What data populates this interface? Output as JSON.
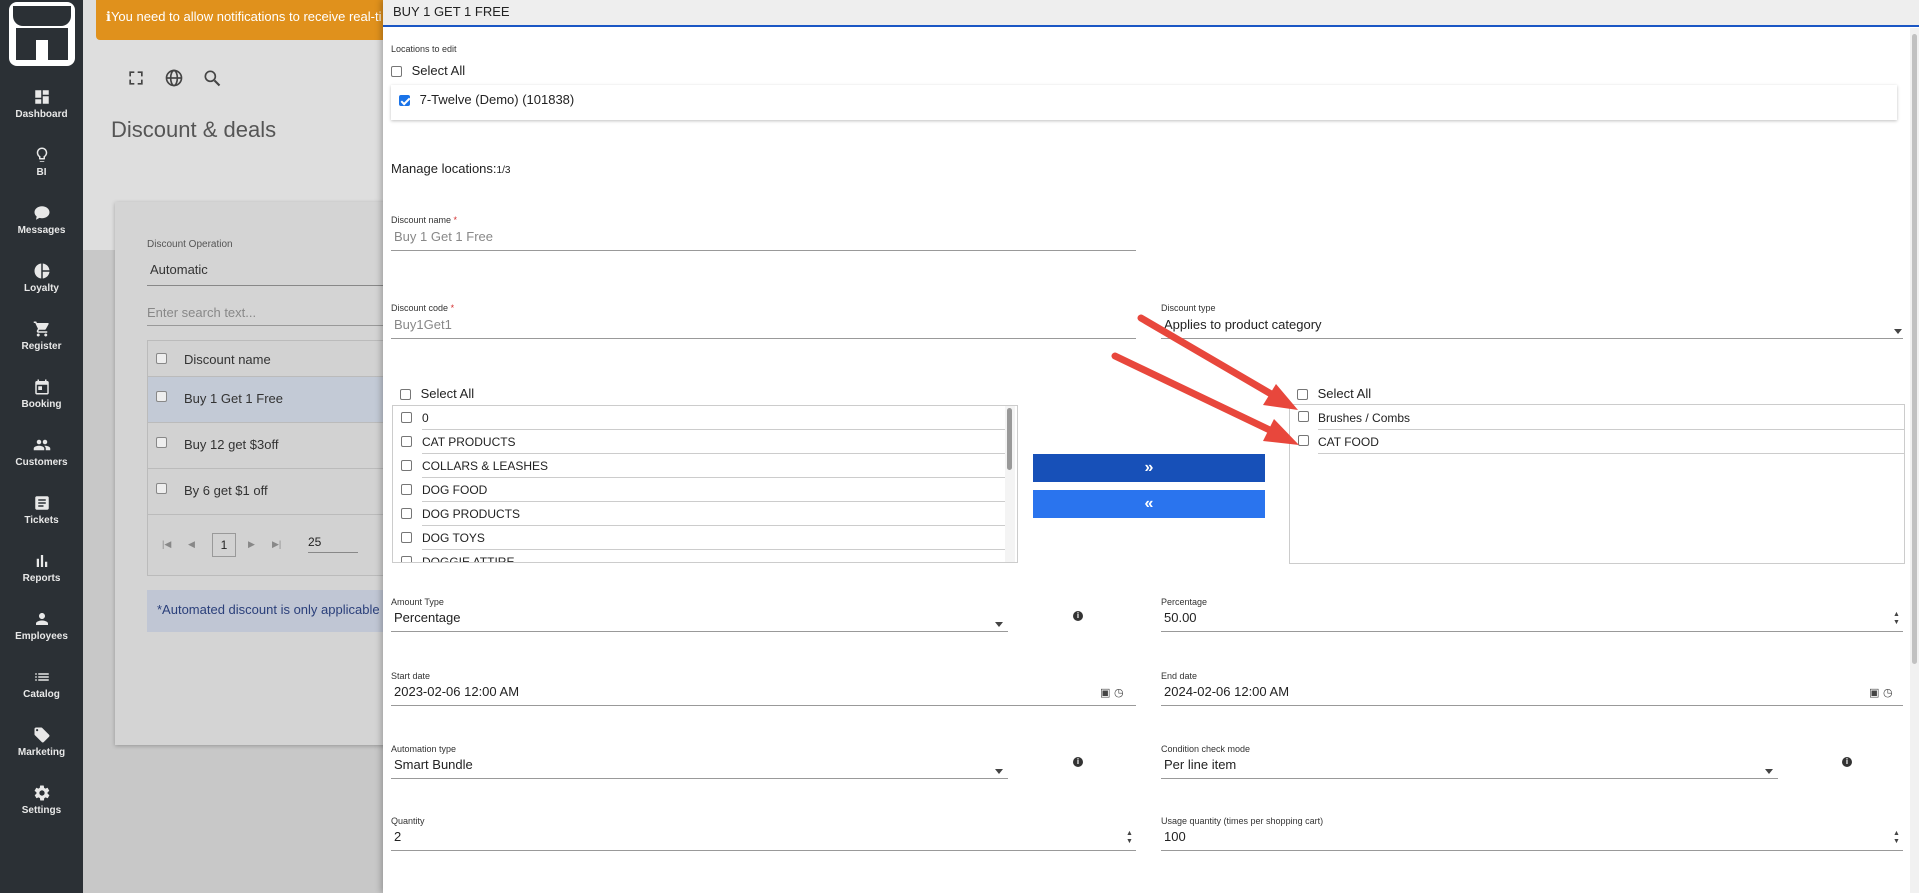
{
  "sidebar": {
    "items": [
      {
        "label": "Dashboard",
        "icon": "dashboard-icon"
      },
      {
        "label": "BI",
        "icon": "lightbulb-icon"
      },
      {
        "label": "Messages",
        "icon": "chat-bubble-icon"
      },
      {
        "label": "Loyalty",
        "icon": "pie-chart-icon"
      },
      {
        "label": "Register",
        "icon": "cart-icon"
      },
      {
        "label": "Booking",
        "icon": "calendar-icon"
      },
      {
        "label": "Customers",
        "icon": "people-icon"
      },
      {
        "label": "Tickets",
        "icon": "ticket-icon"
      },
      {
        "label": "Reports",
        "icon": "bar-chart-icon"
      },
      {
        "label": "Employees",
        "icon": "person-icon"
      },
      {
        "label": "Catalog",
        "icon": "list-icon"
      },
      {
        "label": "Marketing",
        "icon": "tag-icon"
      },
      {
        "label": "Settings",
        "icon": "gear-icon"
      }
    ]
  },
  "background": {
    "notification": "You need to allow notifications to receive real-ti",
    "page_title": "Discount & deals",
    "operation_label": "Discount Operation",
    "operation_value": "Automatic",
    "search_placeholder": "Enter search text...",
    "table_header": "Discount name",
    "rows": [
      "Buy 1 Get 1 Free",
      "Buy 12 get $3off",
      "By 6 get $1 off"
    ],
    "page_number": "1",
    "page_size": "25",
    "note": "*Automated discount is only applicable"
  },
  "panel": {
    "title": "BUY 1 GET 1 FREE",
    "locations_label": "Locations to edit",
    "select_all": "Select All",
    "location_item": "7-Twelve (Demo) (101838)",
    "manage_locations_label": "Manage locations:",
    "manage_locations_count": "1/3",
    "discount_name_label": "Discount name",
    "discount_name_value": "Buy 1 Get 1 Free",
    "discount_code_label": "Discount code",
    "discount_code_value": "Buy1Get1",
    "discount_type_label": "Discount type",
    "discount_type_value": "Applies to product category",
    "required_mark": "*",
    "available_categories": [
      "0",
      "CAT PRODUCTS",
      "COLLARS & LEASHES",
      "DOG FOOD",
      "DOG PRODUCTS",
      "DOG TOYS",
      "DOGGIE ATTIRE"
    ],
    "selected_categories": [
      "Brushes / Combs",
      "CAT FOOD"
    ],
    "move_right_label": "»",
    "move_left_label": "«",
    "amount_type_label": "Amount Type",
    "amount_type_value": "Percentage",
    "percentage_label": "Percentage",
    "percentage_value": "50.00",
    "start_date_label": "Start date",
    "start_date_value": "2023-02-06 12:00 AM",
    "end_date_label": "End date",
    "end_date_value": "2024-02-06 12:00 AM",
    "automation_type_label": "Automation type",
    "automation_type_value": "Smart Bundle",
    "condition_mode_label": "Condition check mode",
    "condition_mode_value": "Per line item",
    "quantity_label": "Quantity",
    "quantity_value": "2",
    "usage_quantity_label": "Usage quantity (times per shopping cart)",
    "usage_quantity_value": "100"
  },
  "colors": {
    "sidebar_bg": "#2b3035",
    "accent_blue": "#1750b8",
    "notification_orange": "#e0911c",
    "annotation_red": "#e8473c"
  }
}
